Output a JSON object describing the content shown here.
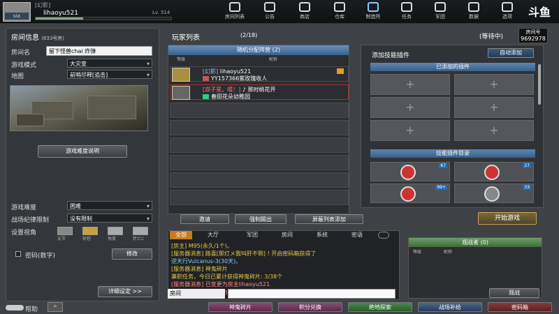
{
  "topbar": {
    "clan_tag": "[幻影]",
    "player_name": "lihaoyu521",
    "level": "Lv. 514",
    "exp_fraction": 0.35,
    "nav": [
      {
        "label": "房间列表",
        "icon": "home-icon"
      },
      {
        "label": "公告",
        "icon": "megaphone-icon"
      },
      {
        "label": "商店",
        "icon": "shop-icon"
      },
      {
        "label": "仓库",
        "icon": "warehouse-icon"
      },
      {
        "label": "制造所",
        "icon": "factory-icon"
      },
      {
        "label": "任务",
        "icon": "mission-icon"
      },
      {
        "label": "军团",
        "icon": "legion-icon"
      },
      {
        "label": "数据",
        "icon": "info-icon"
      },
      {
        "label": "选项",
        "icon": "settings-icon"
      }
    ],
    "logo_text": "斗鱼"
  },
  "room_info": {
    "header": "房间信息",
    "room_no": "(833号房)",
    "name_label": "房间名",
    "name_value": "留下怪兽chai 炸弹",
    "mode_label": "游戏模式",
    "mode_value": "大灾变",
    "map_label": "地图",
    "map_value": "前哨尽释[追击]",
    "difficulty_desc_btn": "游戏难度说明",
    "difficulty_label": "游戏难度",
    "difficulty_value": "困难",
    "discipline_label": "战场纪律限制",
    "discipline_value": "没有限制",
    "view_label": "设置视角",
    "view_options": [
      "友军",
      "射程",
      "角度",
      "死亡C"
    ],
    "password_label": "密码(数字)",
    "modify_btn": "修改",
    "detail_btn": "详细设定 >>",
    "help_label": "帮助"
  },
  "player_list": {
    "header": "玩家列表",
    "count": "(2/18)",
    "status": "(等待中)",
    "room_number_label": "房间号",
    "room_number": "9692978",
    "team_bar": "随机分配阵营  (2)",
    "col_level": "等级",
    "col_name": "昵称",
    "players": [
      {
        "tag": "[幻影]",
        "name": "lihaoyu521",
        "sub": "YY157366紫玫瑰收人"
      },
      {
        "tag": "[双子星。嘻！]",
        "name": "♪ 那时桃花开",
        "sub": "春田花朵幼稚园"
      }
    ],
    "btn_invite": "邀请",
    "btn_kick": "强制踢出",
    "btn_block": "屏蔽列表添加"
  },
  "skills": {
    "header": "添加技能插件",
    "auto_add": "自动添加",
    "added_header": "已添加的插件",
    "catalog_header": "技能插件目录",
    "badges": [
      "67",
      "27",
      "99+",
      "33"
    ],
    "start_btn": "开始游戏"
  },
  "chat": {
    "tabs": [
      "全部",
      "大厅",
      "军团",
      "房间",
      "系统",
      "密语"
    ],
    "lines": [
      {
        "text": "[房主] M95(永久/1个)。",
        "color": "#e8c84a"
      },
      {
        "text": "[服务器消息]    路喜[那灯メ我叫肝不倒] ! 开启密码箱获得了",
        "color": "#e8c84a"
      },
      {
        "text": "逆天行Vulcanus-3(30天)。",
        "color": "#7fd0ff"
      },
      {
        "text": "[服务器消息]    神鬼碎片",
        "color": "#e8c84a"
      },
      {
        "text": "兼职任务，今日已累计获得神鬼碎片: 3/38个",
        "color": "#e8c84a"
      },
      {
        "text": "[服务器消息]    已变更为房主lihaoyu521",
        "color": "#ff8a8a"
      },
      {
        "text": "[服务器消息]    已变更为房主lihaoyu521",
        "color": "#ff8a8a"
      }
    ],
    "input_channel": "房间"
  },
  "observers": {
    "header": "观战者  (0)",
    "col_level": "等级",
    "col_name": "昵称",
    "btn": "观战"
  },
  "bottom": {
    "buttons": [
      "神鬼碎片",
      "积分兑换",
      "绝地探索",
      "战场补给",
      "密码箱"
    ]
  }
}
